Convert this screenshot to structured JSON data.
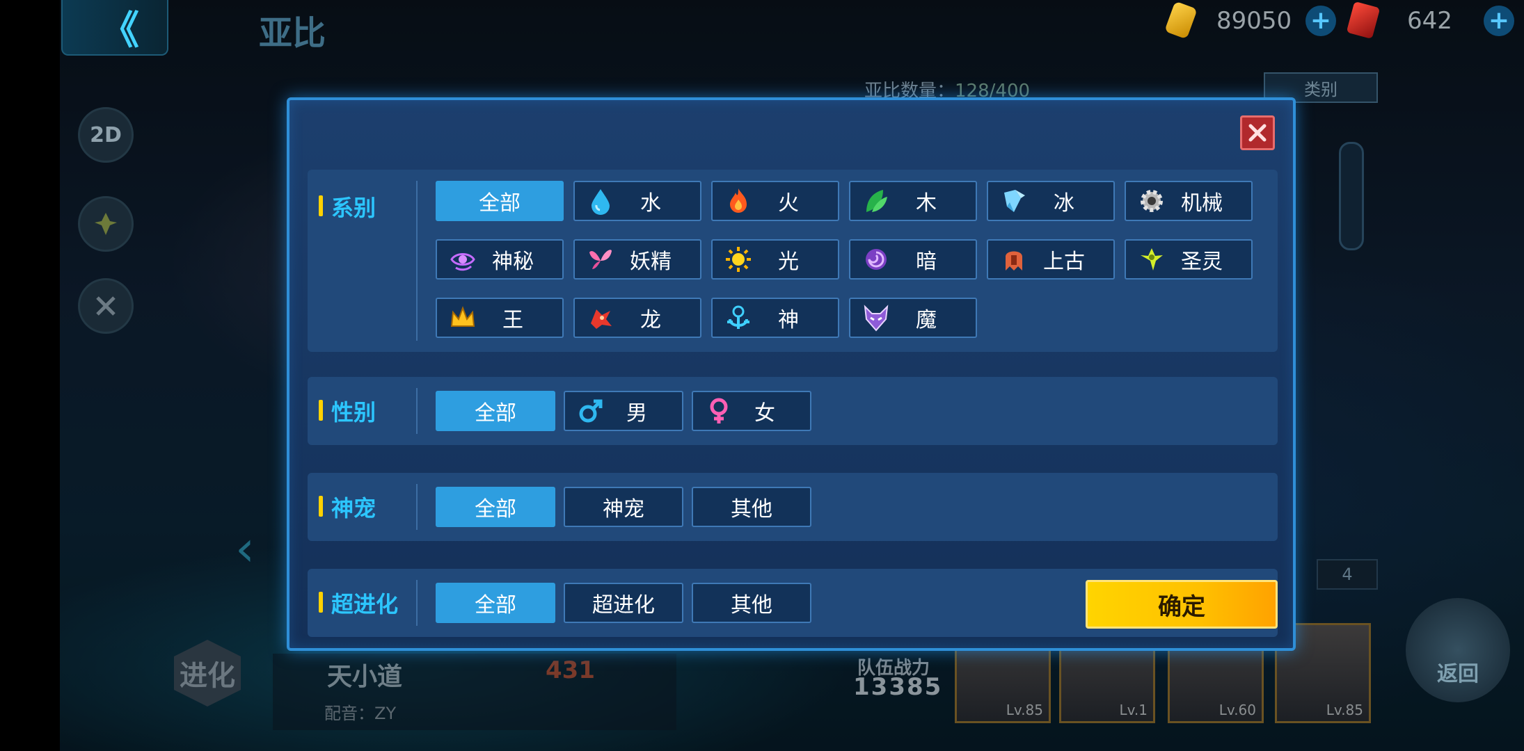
{
  "header": {
    "back_label": "《",
    "title": "亚比",
    "currency_1": "89050",
    "currency_2": "642",
    "plus": "+"
  },
  "side_buttons": [
    "2D",
    "",
    ""
  ],
  "background": {
    "pet_count_label": "亚比数量：",
    "pet_count_value": "128/400",
    "category_button": "类别",
    "pet_name": "天小道",
    "power": "431",
    "voice": "配音：ZY",
    "evolve": "进化",
    "team_power_label": "队伍战力",
    "team_power_value": "13385",
    "team_levels": [
      "Lv.85",
      "Lv.1",
      "Lv.60",
      "Lv.85"
    ],
    "slot_count": "4",
    "return_label": "返回"
  },
  "filter_modal": {
    "sections": [
      {
        "label": "系别",
        "options": [
          {
            "label": "全部",
            "active": true,
            "icon": ""
          },
          {
            "label": "水",
            "icon": "water-drop-icon"
          },
          {
            "label": "火",
            "icon": "flame-icon"
          },
          {
            "label": "木",
            "icon": "leaf-icon"
          },
          {
            "label": "冰",
            "icon": "ice-crystal-icon"
          },
          {
            "label": "机械",
            "icon": "gear-icon"
          },
          {
            "label": "神秘",
            "icon": "mystic-eye-icon"
          },
          {
            "label": "妖精",
            "icon": "fairy-wing-icon"
          },
          {
            "label": "光",
            "icon": "sun-icon"
          },
          {
            "label": "暗",
            "icon": "dark-swirl-icon"
          },
          {
            "label": "上古",
            "icon": "ancient-beast-icon"
          },
          {
            "label": "圣灵",
            "icon": "holy-spirit-icon"
          },
          {
            "label": "王",
            "icon": "crown-icon"
          },
          {
            "label": "龙",
            "icon": "dragon-icon"
          },
          {
            "label": "神",
            "icon": "divine-icon"
          },
          {
            "label": "魔",
            "icon": "demon-mask-icon"
          }
        ]
      },
      {
        "label": "性别",
        "options": [
          {
            "label": "全部",
            "active": true,
            "icon": ""
          },
          {
            "label": "男",
            "icon": "male-icon"
          },
          {
            "label": "女",
            "icon": "female-icon"
          }
        ]
      },
      {
        "label": "神宠",
        "options": [
          {
            "label": "全部",
            "active": true
          },
          {
            "label": "神宠"
          },
          {
            "label": "其他"
          }
        ]
      },
      {
        "label": "超进化",
        "options": [
          {
            "label": "全部",
            "active": true
          },
          {
            "label": "超进化"
          },
          {
            "label": "其他"
          }
        ]
      }
    ],
    "confirm_label": "确定"
  },
  "colors": {
    "accent": "#2cc6ff",
    "active_option": "#2e9ee0",
    "confirm": "#ffc000",
    "close": "#b1292c"
  }
}
